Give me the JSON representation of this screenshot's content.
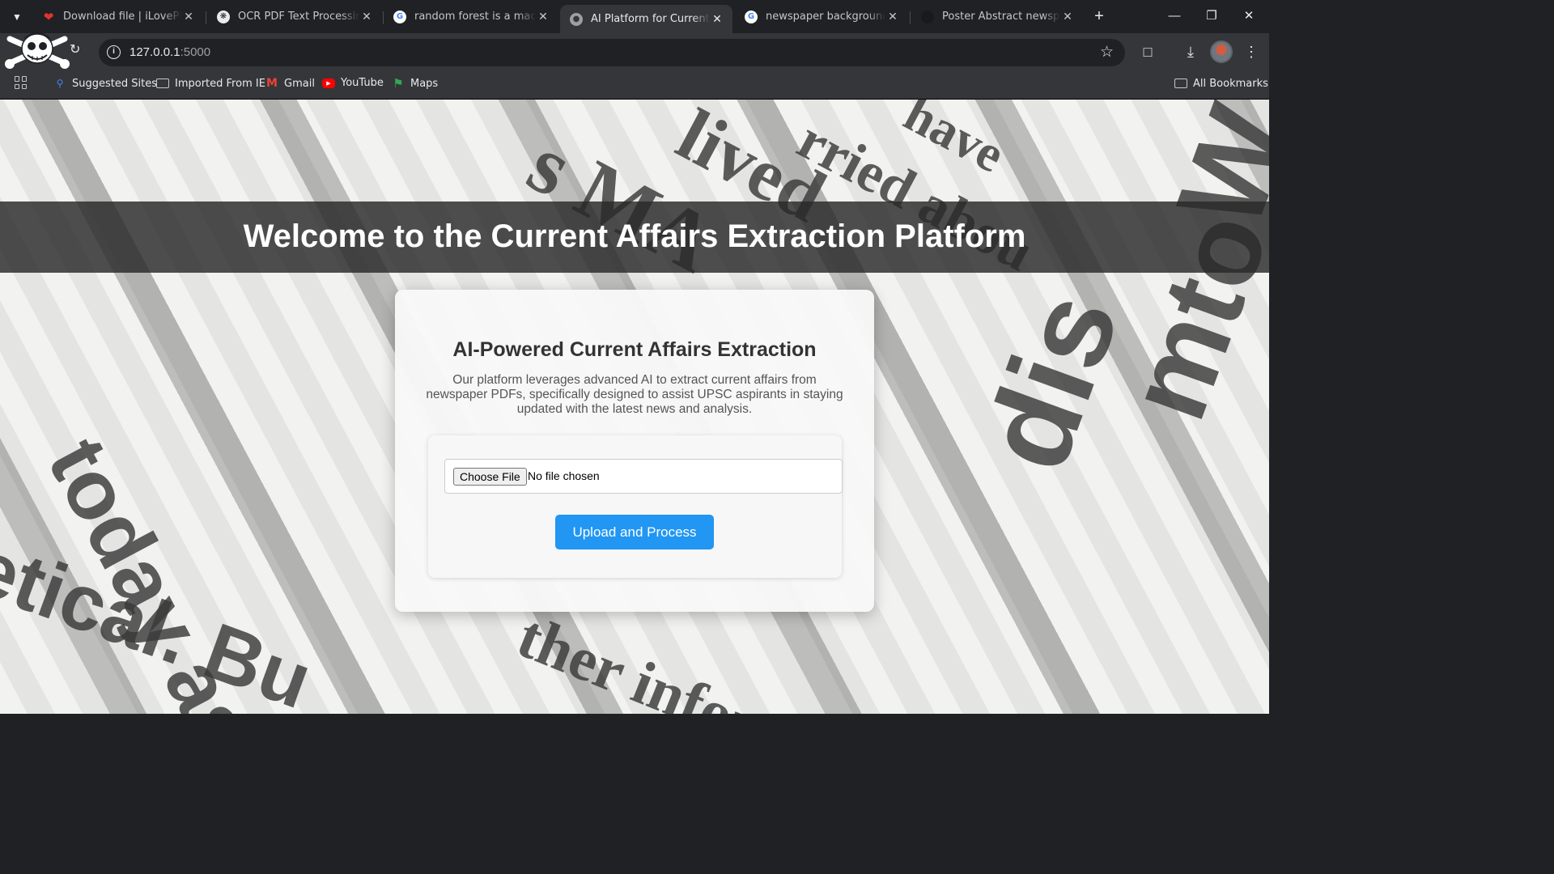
{
  "browser": {
    "tabs": [
      {
        "title": "Download file | iLovePDF",
        "active": false,
        "favicon": "heart-icon",
        "favicon_color": "#e5322d"
      },
      {
        "title": "OCR PDF Text Processing",
        "active": false,
        "favicon": "openai-icon",
        "favicon_color": "#e8eaed"
      },
      {
        "title": "random forest is a machine",
        "active": false,
        "favicon": "google-icon",
        "favicon_color": "#ffffff"
      },
      {
        "title": "AI Platform for Current Affa",
        "active": true,
        "favicon": "globe-icon",
        "favicon_color": "#9aa0a6"
      },
      {
        "title": "newspaper background - G",
        "active": false,
        "favicon": "google-icon",
        "favicon_color": "#ffffff"
      },
      {
        "title": "Poster Abstract newspaper",
        "active": false,
        "favicon": "dark-site-icon",
        "favicon_color": "#1a1a1a"
      }
    ],
    "url_host": "127.0.0.1",
    "url_port": ":5000",
    "bookmarks": {
      "suggested": "Suggested Sites",
      "imported": "Imported From IE",
      "gmail": "Gmail",
      "youtube": "YouTube",
      "maps": "Maps",
      "all": "All Bookmarks"
    }
  },
  "page": {
    "hero_title": "Welcome to the Current Affairs Extraction Platform",
    "card": {
      "title": "AI-Powered Current Affairs Extraction",
      "description": "Our platform leverages advanced AI to extract current affairs from newspaper PDFs, specifically designed to assist UPSC aspirants in staying updated with the latest news and analysis.",
      "choose_file_label": "Choose File",
      "no_file_text": "No file chosen",
      "upload_button": "Upload and Process"
    },
    "background_words": [
      "lived",
      "rried abou",
      "have",
      "s MA",
      "today as",
      "etical. Bu",
      "ther infor",
      "dis",
      "mto",
      "W"
    ]
  },
  "colors": {
    "accent_button": "#2196f3",
    "hero_band": "#282828",
    "chrome_dark": "#202124",
    "chrome_toolbar": "#35363a"
  }
}
